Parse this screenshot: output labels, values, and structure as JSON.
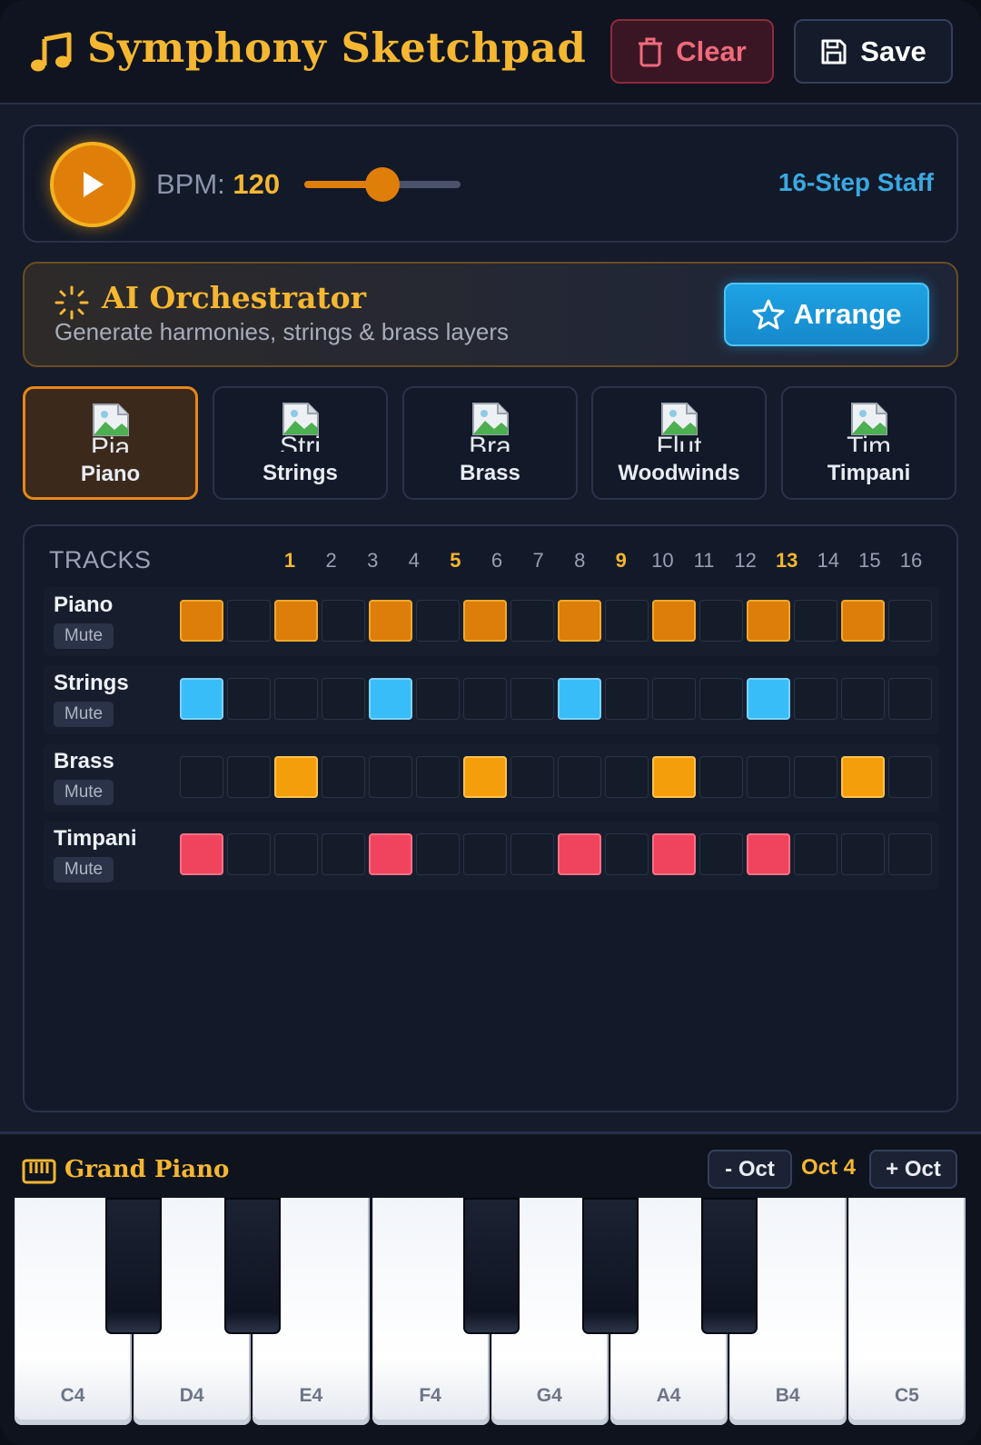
{
  "header": {
    "title": "Symphony Sketchpad",
    "clear_label": "Clear",
    "save_label": "Save"
  },
  "transport": {
    "bpm_label": "BPM:",
    "bpm_value": "120",
    "tempo_fraction": 0.5,
    "staff_label": "16-Step Staff"
  },
  "ai": {
    "title": "AI Orchestrator",
    "subtitle": "Generate harmonies, strings & brass layers",
    "arrange_label": "Arrange"
  },
  "instruments": [
    {
      "label": "Piano",
      "clipped": "Pia",
      "active": true
    },
    {
      "label": "Strings",
      "clipped": "Stri",
      "active": false
    },
    {
      "label": "Brass",
      "clipped": "Bra",
      "active": false
    },
    {
      "label": "Woodwinds",
      "clipped": "Flut",
      "active": false
    },
    {
      "label": "Timpani",
      "clipped": "Tim",
      "active": false
    }
  ],
  "sequencer": {
    "tracks_label": "TRACKS",
    "steps": [
      "1",
      "2",
      "3",
      "4",
      "5",
      "6",
      "7",
      "8",
      "9",
      "10",
      "11",
      "12",
      "13",
      "14",
      "15",
      "16"
    ],
    "accent_steps": [
      1,
      5,
      9,
      13
    ],
    "tracks": [
      {
        "name": "Piano",
        "mute_label": "Mute",
        "kind": "piano",
        "steps": [
          1,
          0,
          1,
          0,
          1,
          0,
          1,
          0,
          1,
          0,
          1,
          0,
          1,
          0,
          1,
          0
        ]
      },
      {
        "name": "Strings",
        "mute_label": "Mute",
        "kind": "strings",
        "steps": [
          1,
          0,
          0,
          0,
          1,
          0,
          0,
          0,
          1,
          0,
          0,
          0,
          1,
          0,
          0,
          0
        ]
      },
      {
        "name": "Brass",
        "mute_label": "Mute",
        "kind": "brass",
        "steps": [
          0,
          0,
          1,
          0,
          0,
          0,
          1,
          0,
          0,
          0,
          1,
          0,
          0,
          0,
          1,
          0
        ]
      },
      {
        "name": "Timpani",
        "mute_label": "Mute",
        "kind": "timpani",
        "steps": [
          1,
          0,
          0,
          0,
          1,
          0,
          0,
          0,
          1,
          0,
          1,
          0,
          1,
          0,
          0,
          0
        ]
      }
    ]
  },
  "keyboard": {
    "title": "Grand Piano",
    "oct_down_label": "- Oct",
    "oct_label": "Oct 4",
    "oct_up_label": "+ Oct",
    "white_keys": [
      "C4",
      "D4",
      "E4",
      "F4",
      "G4",
      "A4",
      "B4",
      "C5"
    ]
  },
  "colors": {
    "accent": "#f5b731",
    "piano": "#dd7d0a",
    "strings": "#38bdf8",
    "brass": "#f59e0b",
    "timpani": "#f0435e",
    "arrange": "#1ea3e4"
  },
  "icons": {
    "title": "music-note-icon",
    "clear": "trash-icon",
    "save": "floppy-disk-icon",
    "play": "play-icon",
    "ai": "sparkle-loader-icon",
    "arrange": "star-icon",
    "instrument": "broken-image-icon",
    "keyboard": "piano-keyboard-icon"
  }
}
